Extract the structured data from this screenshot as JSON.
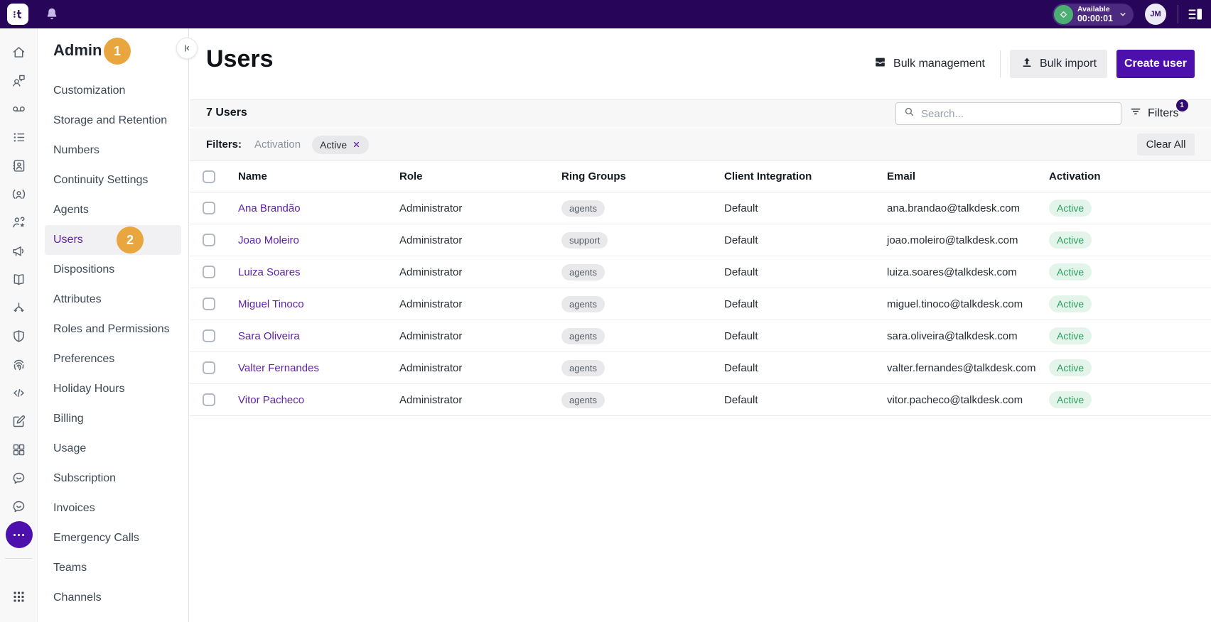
{
  "colors": {
    "topbar_bg": "#27065A",
    "topbar_pill_bg": "#4B2A80",
    "status_green": "#4CAF72",
    "accent_purple": "#4E10AC",
    "link_purple": "#5E21AC",
    "badge_orange": "#E9A63F",
    "filters_badge_bg": "#2F0B73",
    "active_text": "#2C9D5D",
    "active_bg": "#E3F5EB"
  },
  "topbar": {
    "status_label": "Available",
    "status_timer": "00:00:01",
    "avatar_initials": "JM"
  },
  "sidebar": {
    "title": "Admin",
    "title_badge": "1",
    "rail": [
      "home-icon",
      "conversations-icon",
      "voicemail-icon",
      "checklist-icon",
      "contacts-icon",
      "agent-icon",
      "team-star-icon",
      "campaign-icon",
      "knowledge-icon",
      "routing-icon",
      "security-icon",
      "fingerprint-icon",
      "developer-icon",
      "compose-icon",
      "dashboard-icon",
      "feedback-icon",
      "chat-icon",
      "more-icon",
      "divider",
      "apps-icon"
    ],
    "items": [
      {
        "label": "Customization"
      },
      {
        "label": "Storage and Retention"
      },
      {
        "label": "Numbers"
      },
      {
        "label": "Continuity Settings"
      },
      {
        "label": "Agents"
      },
      {
        "label": "Users",
        "selected": true,
        "badge": "2"
      },
      {
        "label": "Dispositions"
      },
      {
        "label": "Attributes"
      },
      {
        "label": "Roles and Permissions"
      },
      {
        "label": "Preferences"
      },
      {
        "label": "Holiday Hours"
      },
      {
        "label": "Billing"
      },
      {
        "label": "Usage"
      },
      {
        "label": "Subscription"
      },
      {
        "label": "Invoices"
      },
      {
        "label": "Emergency Calls"
      },
      {
        "label": "Teams"
      },
      {
        "label": "Channels"
      }
    ]
  },
  "header": {
    "title": "Users",
    "bulk_management_label": "Bulk management",
    "bulk_import_label": "Bulk import",
    "create_user_label": "Create user"
  },
  "toolbar": {
    "count_label": "7 Users",
    "search_placeholder": "Search...",
    "filters_label": "Filters",
    "filters_badge": "1"
  },
  "filters_bar": {
    "label": "Filters:",
    "filter_name": "Activation",
    "chip_value": "Active",
    "clear_all_label": "Clear All"
  },
  "table": {
    "columns": [
      "Name",
      "Role",
      "Ring Groups",
      "Client Integration",
      "Email",
      "Activation"
    ],
    "rows": [
      {
        "name": "Ana Brandão",
        "role": "Administrator",
        "ring_group": "agents",
        "client_integration": "Default",
        "email": "ana.brandao@talkdesk.com",
        "activation": "Active"
      },
      {
        "name": "Joao Moleiro",
        "role": "Administrator",
        "ring_group": "support",
        "client_integration": "Default",
        "email": "joao.moleiro@talkdesk.com",
        "activation": "Active"
      },
      {
        "name": "Luiza Soares",
        "role": "Administrator",
        "ring_group": "agents",
        "client_integration": "Default",
        "email": "luiza.soares@talkdesk.com",
        "activation": "Active"
      },
      {
        "name": "Miguel Tinoco",
        "role": "Administrator",
        "ring_group": "agents",
        "client_integration": "Default",
        "email": "miguel.tinoco@talkdesk.com",
        "activation": "Active"
      },
      {
        "name": "Sara Oliveira",
        "role": "Administrator",
        "ring_group": "agents",
        "client_integration": "Default",
        "email": "sara.oliveira@talkdesk.com",
        "activation": "Active"
      },
      {
        "name": "Valter Fernandes",
        "role": "Administrator",
        "ring_group": "agents",
        "client_integration": "Default",
        "email": "valter.fernandes@talkdesk.com",
        "activation": "Active"
      },
      {
        "name": "Vitor Pacheco",
        "role": "Administrator",
        "ring_group": "agents",
        "client_integration": "Default",
        "email": "vitor.pacheco@talkdesk.com",
        "activation": "Active"
      }
    ]
  }
}
